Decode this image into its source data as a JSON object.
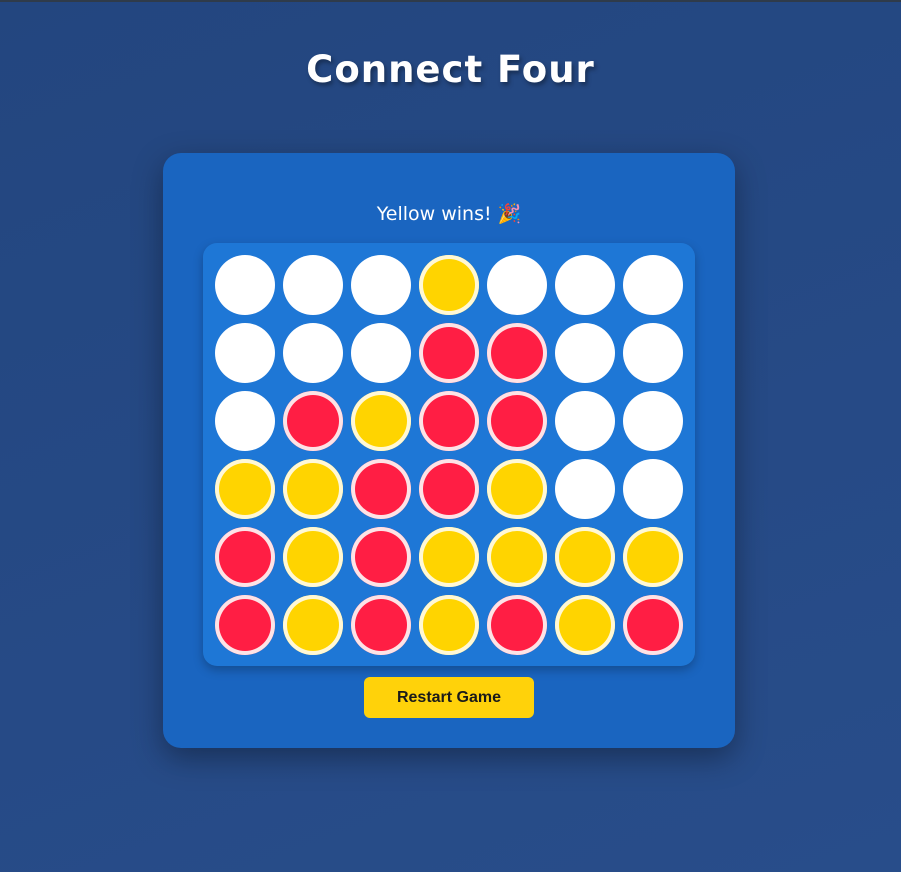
{
  "title": "Connect Four",
  "status": "Yellow wins! 🎉",
  "restart_label": "Restart Game",
  "colors": {
    "background": "#23467f",
    "panel": "#1a65c0",
    "board": "#1e77d6",
    "empty": "#ffffff",
    "red": "#ff1e44",
    "yellow": "#ffd400",
    "button": "#ffd20a"
  },
  "board": {
    "rows": 6,
    "cols": 7,
    "grid": [
      [
        "empty",
        "empty",
        "empty",
        "yellow",
        "empty",
        "empty",
        "empty"
      ],
      [
        "empty",
        "empty",
        "empty",
        "red",
        "red",
        "empty",
        "empty"
      ],
      [
        "empty",
        "red",
        "yellow",
        "red",
        "red",
        "empty",
        "empty"
      ],
      [
        "yellow",
        "yellow",
        "red",
        "red",
        "yellow",
        "empty",
        "empty"
      ],
      [
        "red",
        "yellow",
        "red",
        "yellow",
        "yellow",
        "yellow",
        "yellow"
      ],
      [
        "red",
        "yellow",
        "red",
        "yellow",
        "red",
        "yellow",
        "red"
      ]
    ]
  }
}
